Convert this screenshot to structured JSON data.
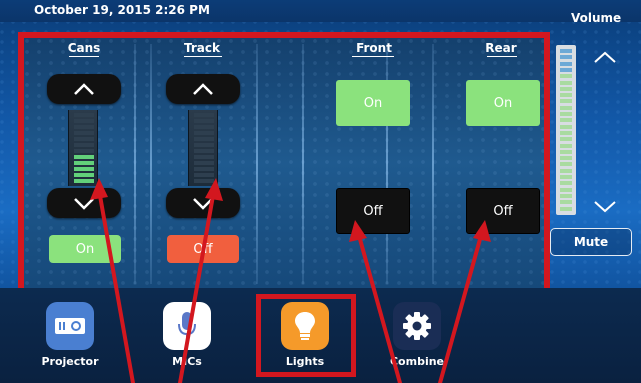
{
  "status_bar": {
    "datetime": "October 19, 2015 2:26 PM"
  },
  "volume": {
    "title": "Volume",
    "level": 0.85,
    "mute_label": "Mute"
  },
  "zones": [
    {
      "label": "Cans",
      "type": "dimmer",
      "level": 0.45,
      "button_label": "On",
      "button_state": "on"
    },
    {
      "label": "Track",
      "type": "dimmer",
      "level": 0.0,
      "button_label": "Off",
      "button_state": "off"
    },
    {
      "label": "Front",
      "type": "switch",
      "on_label": "On",
      "off_label": "Off"
    },
    {
      "label": "Rear",
      "type": "switch",
      "on_label": "On",
      "off_label": "Off"
    }
  ],
  "nav": [
    {
      "label": "Projector",
      "icon": "projector-icon",
      "color": "#4a7fd1"
    },
    {
      "label": "MICs",
      "icon": "microphone-icon",
      "color": "#ffffff"
    },
    {
      "label": "Lights",
      "icon": "lightbulb-icon",
      "color": "#f59a2a"
    },
    {
      "label": "Combine",
      "icon": "gear-icon",
      "color": "#1a2d55"
    }
  ],
  "colors": {
    "annotation": "#d3171f",
    "on_green": "#8be27d",
    "off_orange": "#f15f3e"
  }
}
